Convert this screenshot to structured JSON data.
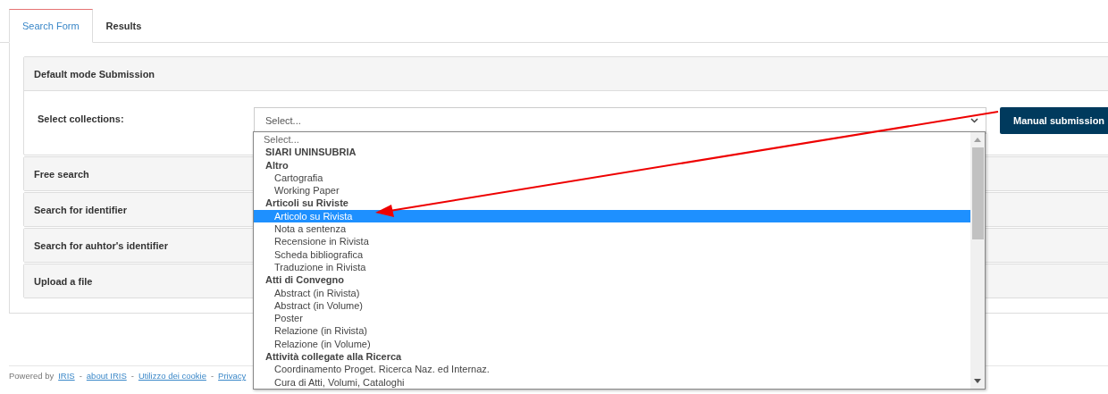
{
  "tabs": [
    {
      "label": "Search Form",
      "selected": true
    },
    {
      "label": "Results",
      "selected": false
    }
  ],
  "panels": [
    {
      "title": "Default mode Submission",
      "expanded": true,
      "field_label": "Select collections:",
      "select": {
        "value": "Select..."
      },
      "button": "Manual submission"
    },
    {
      "title": "Free search",
      "expanded": false
    },
    {
      "title": "Search for identifier",
      "expanded": false
    },
    {
      "title": "Search for auhtor's identifier",
      "expanded": false
    },
    {
      "title": "Upload a file",
      "expanded": false
    }
  ],
  "dropdown": {
    "placeholder": "Select...",
    "groups": [
      {
        "label": "SIARI UNINSUBRIA"
      },
      {
        "label": "Altro",
        "options": [
          {
            "label": "Cartografia",
            "selected": false
          },
          {
            "label": "Working Paper",
            "selected": false
          }
        ]
      },
      {
        "label": "Articoli su Riviste",
        "options": [
          {
            "label": "Articolo su Rivista",
            "selected": true
          },
          {
            "label": "Nota a sentenza",
            "selected": false
          },
          {
            "label": "Recensione in Rivista",
            "selected": false
          },
          {
            "label": "Scheda bibliografica",
            "selected": false
          },
          {
            "label": "Traduzione in Rivista",
            "selected": false
          }
        ]
      },
      {
        "label": "Atti di Convegno",
        "options": [
          {
            "label": "Abstract (in Rivista)",
            "selected": false
          },
          {
            "label": "Abstract (in Volume)",
            "selected": false
          },
          {
            "label": "Poster",
            "selected": false
          },
          {
            "label": "Relazione (in Rivista)",
            "selected": false
          },
          {
            "label": "Relazione (in Volume)",
            "selected": false
          }
        ]
      },
      {
        "label": "Attività collegate alla Ricerca",
        "options": [
          {
            "label": "Coordinamento Proget. Ricerca Naz. ed Internaz.",
            "selected": false
          },
          {
            "label": "Cura di Atti, Volumi, Cataloghi",
            "selected": false
          }
        ]
      }
    ]
  },
  "footer": [
    {
      "kind": "text",
      "text": "Powered by"
    },
    {
      "kind": "link",
      "text": "IRIS"
    },
    {
      "kind": "text",
      "text": "-"
    },
    {
      "kind": "link",
      "text": "about IRIS"
    },
    {
      "kind": "text",
      "text": "-"
    },
    {
      "kind": "link",
      "text": "Utilizzo dei cookie"
    },
    {
      "kind": "text",
      "text": "-"
    },
    {
      "kind": "link",
      "text": "Privacy"
    }
  ]
}
